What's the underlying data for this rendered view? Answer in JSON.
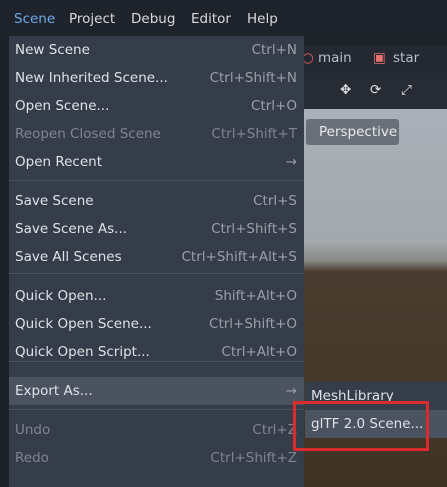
{
  "menubar": [
    "Scene",
    "Project",
    "Debug",
    "Editor",
    "Help"
  ],
  "tabs": [
    "main",
    "star"
  ],
  "viewport": {
    "perspective_label": "Perspective"
  },
  "menu": [
    {
      "label": "New Scene",
      "shortcut": "Ctrl+N"
    },
    {
      "label": "New Inherited Scene...",
      "shortcut": "Ctrl+Shift+N"
    },
    {
      "label": "Open Scene...",
      "shortcut": "Ctrl+O"
    },
    {
      "label": "Reopen Closed Scene",
      "shortcut": "Ctrl+Shift+T",
      "disabled": true
    },
    {
      "label": "Open Recent",
      "shortcut": "→"
    },
    {
      "label": "Save Scene",
      "shortcut": "Ctrl+S"
    },
    {
      "label": "Save Scene As...",
      "shortcut": "Ctrl+Shift+S"
    },
    {
      "label": "Save All Scenes",
      "shortcut": "Ctrl+Shift+Alt+S"
    },
    {
      "label": "Quick Open...",
      "shortcut": "Shift+Alt+O"
    },
    {
      "label": "Quick Open Scene...",
      "shortcut": "Ctrl+Shift+O"
    },
    {
      "label": "Quick Open Script...",
      "shortcut": "Ctrl+Alt+O"
    },
    {
      "label": "Export As...",
      "shortcut": "→",
      "highlighted": true
    },
    {
      "label": "Undo",
      "shortcut": "Ctrl+Z",
      "disabled": true
    },
    {
      "label": "Redo",
      "shortcut": "Ctrl+Shift+Z",
      "disabled": true
    }
  ],
  "submenu": [
    {
      "label": "MeshLibrary"
    },
    {
      "label": "glTF 2.0 Scene...",
      "highlighted": true
    }
  ],
  "colors": {
    "accent": "#6aa9e9",
    "highlight_box": "#d82a2f"
  }
}
